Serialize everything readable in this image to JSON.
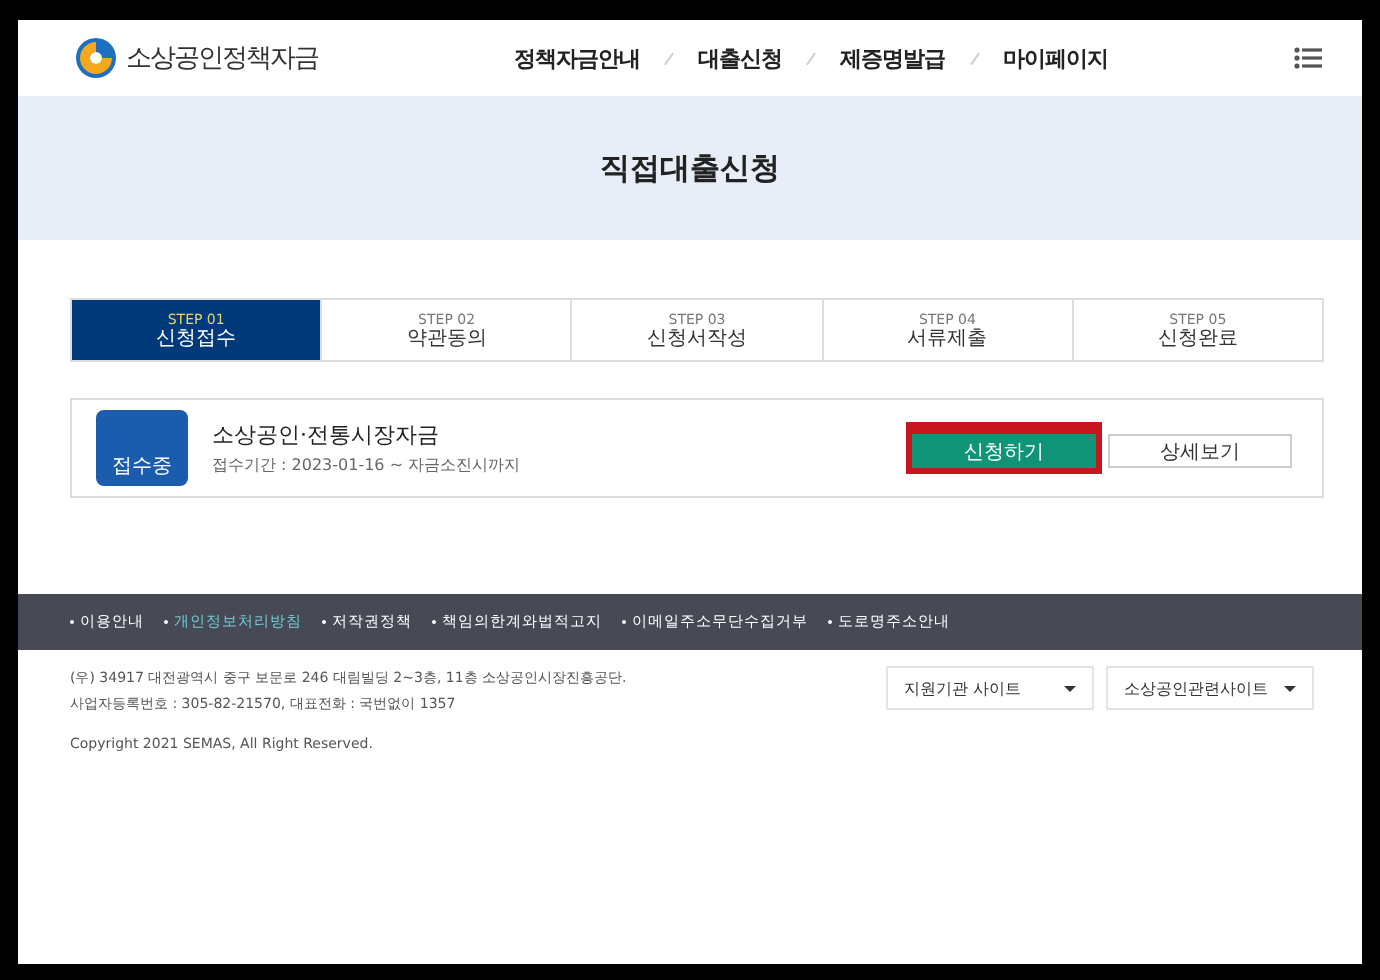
{
  "header": {
    "logo_text": "소상공인정책자금",
    "nav": [
      {
        "label": "정책자금안내"
      },
      {
        "label": "대출신청"
      },
      {
        "label": "제증명발급"
      },
      {
        "label": "마이페이지"
      }
    ]
  },
  "banner": {
    "title": "직접대출신청"
  },
  "steps": [
    {
      "step": "STEP 01",
      "label": "신청접수",
      "selected": true
    },
    {
      "step": "STEP 02",
      "label": "약관동의",
      "selected": false
    },
    {
      "step": "STEP 03",
      "label": "신청서작성",
      "selected": false
    },
    {
      "step": "STEP 04",
      "label": "서류제출",
      "selected": false
    },
    {
      "step": "STEP 05",
      "label": "신청완료",
      "selected": false
    }
  ],
  "loan": {
    "badge": "접수중",
    "title": "소상공인·전통시장자금",
    "period": "접수기간 : 2023-01-16 ~ 자금소진시까지",
    "buttons": [
      {
        "label": "신청하기",
        "kind": "primary",
        "highlighted": true
      },
      {
        "label": "상세보기",
        "kind": "secondary",
        "highlighted": false
      }
    ]
  },
  "footer": {
    "links": [
      {
        "label": "이용안내",
        "selected": false
      },
      {
        "label": "개인정보처리방침",
        "selected": true
      },
      {
        "label": "저작권정책",
        "selected": false
      },
      {
        "label": "책임의한계와법적고지",
        "selected": false
      },
      {
        "label": "이메일주소무단수집거부",
        "selected": false
      },
      {
        "label": "도로명주소안내",
        "selected": false
      }
    ],
    "address": "(우) 34917 대전광역시 중구 보문로 246 대림빌딩 2~3층, 11층 소상공인시장진흥공단.",
    "registration": "사업자등록번호 : 305-82-21570, 대표전화 : 국번없이 1357",
    "copyright": "Copyright 2021 SEMAS, All Right Reserved.",
    "selects": [
      {
        "label": "지원기관 사이트"
      },
      {
        "label": "소상공인관련사이트"
      }
    ]
  }
}
